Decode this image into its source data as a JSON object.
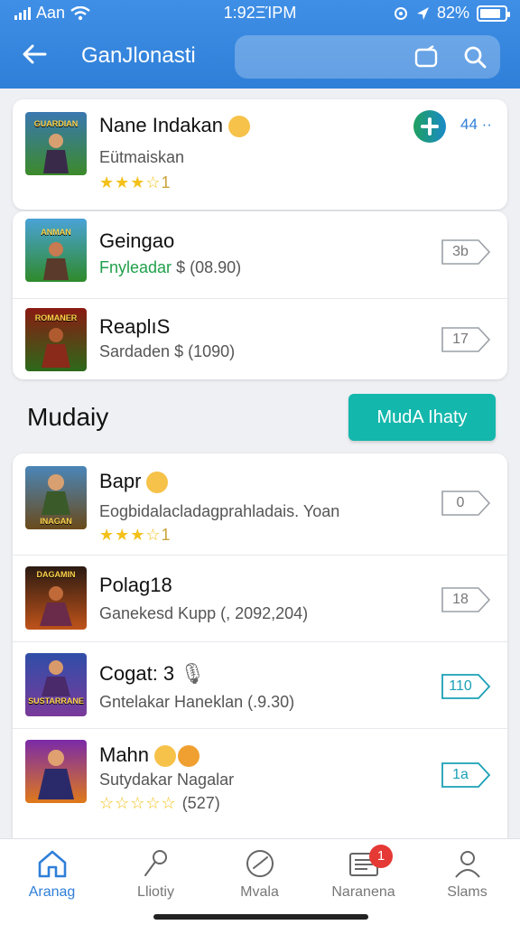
{
  "status": {
    "carrier": "Aan",
    "time": "1:92ΞΊPM",
    "battery": "82%"
  },
  "appbar": {
    "title": "GanJlonasti"
  },
  "featured": [
    {
      "name": "Nane Indakan",
      "subtitle": "Eütmaiskan",
      "rating_count": "1",
      "badge": "44",
      "thumb_title": "GUARDIAN",
      "thumb_bg": [
        "#3a78b0",
        "#3c8a2a"
      ]
    },
    {
      "name": "Geingao",
      "subtitle_green": "Fnyleadar",
      "subtitle": "$ (08.90)",
      "tag": "3b",
      "thumb_title": "ANMAN",
      "thumb_bg": [
        "#4aa3d6",
        "#2f8a2a"
      ]
    },
    {
      "name": "ReaplıS",
      "subtitle": "Sardaden $ (1090)",
      "tag": "17",
      "thumb_title": "ROMANER",
      "thumb_bg": [
        "#8a1a12",
        "#2c6a1a"
      ]
    }
  ],
  "section": {
    "title": "Mudaiy",
    "button": "MudA Ihaty"
  },
  "list": [
    {
      "name": "Bapr",
      "subtitle": "Eogbidalacladagprahladais. Yoan",
      "rating_count": "1",
      "tag": "0",
      "thumb_title": "INAGAN",
      "thumb_bg": [
        "#4a86b8",
        "#6a4a1a"
      ]
    },
    {
      "name": "Polag18",
      "subtitle": "Ganekesd Kupp (, 2092,204)",
      "tag": "18",
      "thumb_title": "DAGAMIN",
      "thumb_bg": [
        "#2a1a12",
        "#c0531a"
      ]
    },
    {
      "name": "Cogat: 3",
      "subtitle": "Gntelakar Haneklan (.9.30)",
      "tag": "110",
      "thumb_title": "SUSTARRANE",
      "thumb_bg": [
        "#2f4ea8",
        "#7a3a9a"
      ]
    },
    {
      "name": "Mahn",
      "subtitle": "Sutydakar Nagalar",
      "rating_count": "(527)",
      "tag": "1a",
      "thumb_title": "",
      "thumb_bg": [
        "#7a2aa8",
        "#e07a1a"
      ]
    }
  ],
  "nav": [
    {
      "label": "Aranag",
      "icon": "home-icon"
    },
    {
      "label": "Lliotiy",
      "icon": "pin-icon"
    },
    {
      "label": "Mvala",
      "icon": "compass-icon"
    },
    {
      "label": "Naranena",
      "icon": "inbox-icon",
      "badge": "1"
    },
    {
      "label": "Slams",
      "icon": "person-icon"
    }
  ],
  "colors": {
    "primary": "#2f7fd8",
    "teal": "#14b7ac",
    "star": "#f3c11a",
    "badge": "#e53935"
  }
}
